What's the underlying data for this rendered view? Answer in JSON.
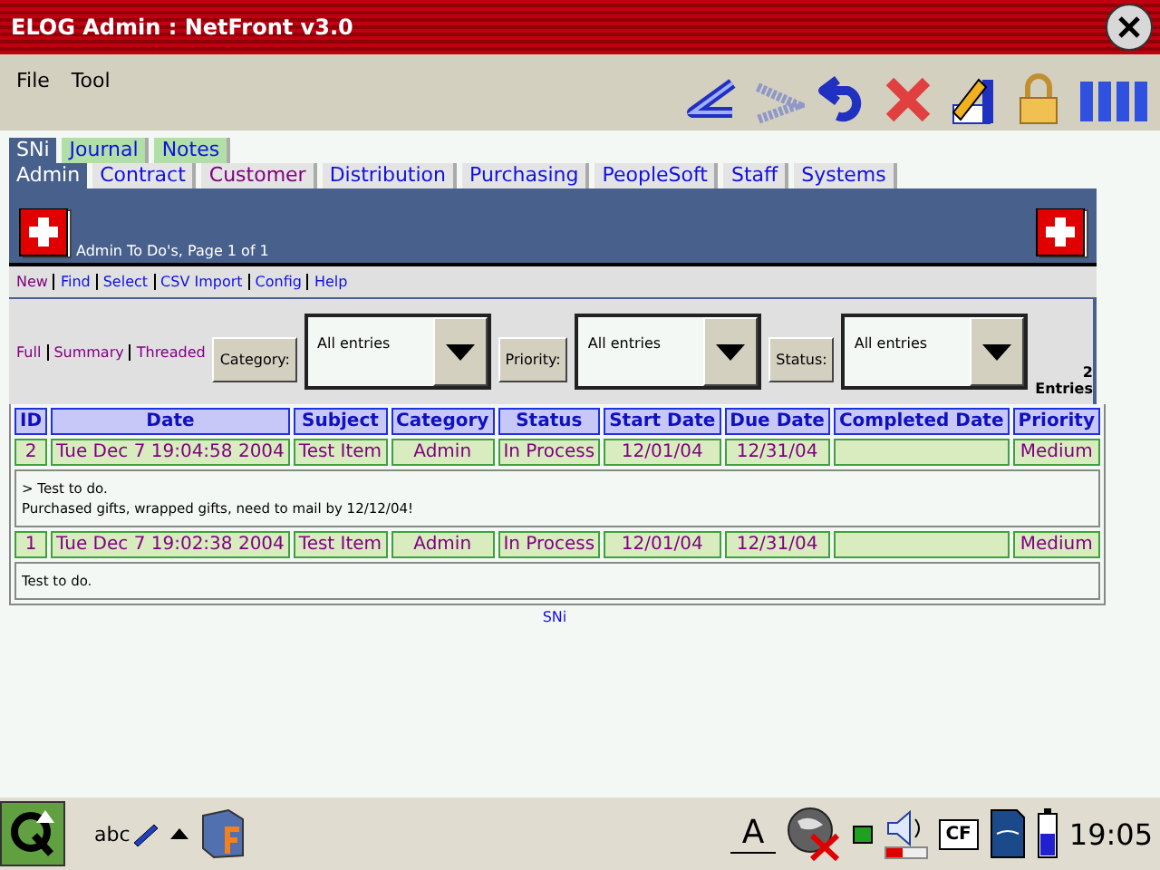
{
  "window": {
    "title": "ELOG Admin : NetFront v3.0"
  },
  "menu": [
    "File",
    "Tool"
  ],
  "tab_rows": [
    {
      "tabs": [
        {
          "label": "SNi",
          "selected": true,
          "visited": false
        },
        {
          "label": "Journal",
          "selected": false,
          "visited": false
        },
        {
          "label": "Notes",
          "selected": false,
          "visited": false
        }
      ]
    },
    {
      "tabs": [
        {
          "label": "Admin",
          "selected": true,
          "visited": false
        },
        {
          "label": "Contract",
          "selected": false,
          "visited": false
        },
        {
          "label": "Customer",
          "selected": false,
          "visited": true
        },
        {
          "label": "Distribution",
          "selected": false,
          "visited": false
        },
        {
          "label": "Purchasing",
          "selected": false,
          "visited": false
        },
        {
          "label": "PeopleSoft",
          "selected": false,
          "visited": false
        },
        {
          "label": "Staff",
          "selected": false,
          "visited": false
        },
        {
          "label": "Systems",
          "selected": false,
          "visited": false
        }
      ]
    }
  ],
  "banner": {
    "title": "Admin To Do's, Page 1 of 1"
  },
  "commands": [
    {
      "label": "New",
      "visited": true
    },
    {
      "label": "Find",
      "visited": false
    },
    {
      "label": "Select",
      "visited": false
    },
    {
      "label": "CSV Import",
      "visited": false
    },
    {
      "label": "Config",
      "visited": false
    },
    {
      "label": "Help",
      "visited": false
    }
  ],
  "views": [
    {
      "label": "Full",
      "visited": true
    },
    {
      "label": "Summary",
      "visited": true
    },
    {
      "label": "Threaded",
      "visited": true
    }
  ],
  "filters": [
    {
      "label": "Category:",
      "value": "All entries"
    },
    {
      "label": "Priority:",
      "value": "All entries"
    },
    {
      "label": "Status:",
      "value": "All entries"
    }
  ],
  "entry_count": {
    "number": "2",
    "label": "Entries"
  },
  "table": {
    "columns": [
      "ID",
      "Date",
      "Subject",
      "Category",
      "Status",
      "Start Date",
      "Due Date",
      "Completed Date",
      "Priority"
    ],
    "rows": [
      {
        "kind": "entry",
        "cells": [
          "2",
          "Tue Dec 7 19:04:58 2004",
          "Test Item",
          "Admin",
          "In Process",
          "12/01/04",
          "12/31/04",
          "",
          "Medium"
        ]
      },
      {
        "kind": "note",
        "lines": [
          "> Test to do.",
          "Purchased gifts, wrapped gifts, need to mail by 12/12/04!"
        ]
      },
      {
        "kind": "entry",
        "cells": [
          "1",
          "Tue Dec 7 19:02:38 2004",
          "Test Item",
          "Admin",
          "In Process",
          "12/01/04",
          "12/31/04",
          "",
          "Medium"
        ]
      },
      {
        "kind": "note",
        "lines": [
          "Test to do."
        ]
      }
    ]
  },
  "footer": "SNi",
  "taskbar": {
    "input_label": "abc",
    "keyboard_label": "A",
    "card_label": "CF",
    "volume": {
      "level": 0.4
    },
    "clock": "19:05"
  }
}
